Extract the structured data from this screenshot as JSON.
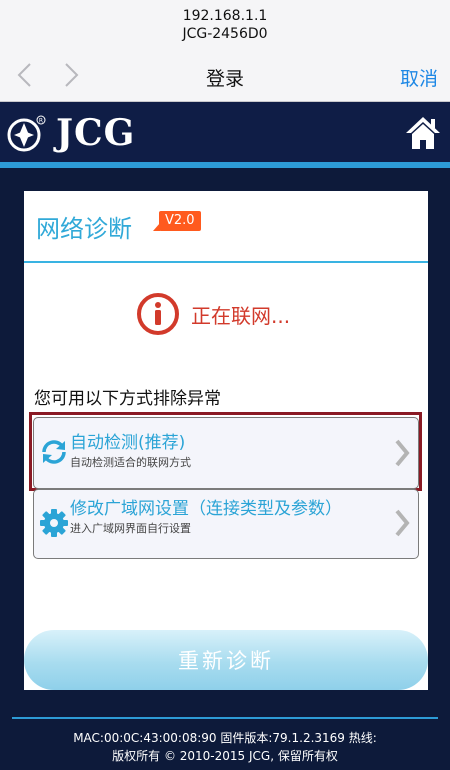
{
  "browser": {
    "host": "192.168.1.1",
    "page_title": "JCG-2456D0",
    "nav_title": "登录",
    "cancel_label": "取消"
  },
  "header": {
    "logo_text": "JCG"
  },
  "card": {
    "title": "网络诊断",
    "version": "V2.0",
    "status": "正在联网...",
    "hint": "您可用以下方式排除异常",
    "options": [
      {
        "title": "自动检测(推荐)",
        "subtitle": "自动检测适合的联网方式"
      },
      {
        "title": "修改广域网设置（连接类型及参数）",
        "subtitle": "进入广域网界面自行设置"
      }
    ],
    "button_label": "重新诊断"
  },
  "footer": {
    "info": "MAC:00:0C:43:00:08:90  固件版本:79.1.2.3169  热线:",
    "copyright": "版权所有 © 2010-2015 JCG, 保留所有权"
  },
  "colors": {
    "header_bg": "#0f1d46",
    "accent_blue": "#2d9bd6",
    "title_blue": "#31a9d8",
    "badge_orange": "#ff5a1e",
    "status_red": "#d23a2b",
    "highlight_frame": "#8a1a24"
  }
}
